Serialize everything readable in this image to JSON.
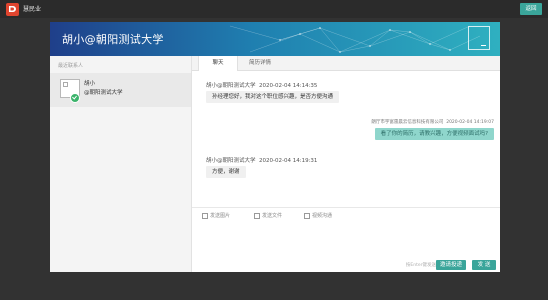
{
  "app": {
    "name": "慧民业",
    "top_button": "返回"
  },
  "modal": {
    "title": "胡小@朝阳测试大学"
  },
  "sidebar": {
    "title": "最近联系人",
    "contacts": [
      {
        "name": "胡小",
        "org": "@朝阳测试大学",
        "status": "online"
      }
    ]
  },
  "tabs": [
    {
      "label": "聊天",
      "active": true
    },
    {
      "label": "简历详情",
      "active": false
    }
  ],
  "messages": [
    {
      "direction": "in",
      "sender": "胡小@朝阳测试大学",
      "time": "2020-02-04 14:14:35",
      "text": "孙经理您好，我对这个职位感兴趣，是否方便沟通"
    },
    {
      "direction": "out",
      "sender": "朗厅市宇富雷晨云信息科技有限公司",
      "time": "2020-02-04 14:19:07",
      "text": "看了你的简历，请教兴趣，方便视频面试吗?"
    },
    {
      "direction": "in",
      "sender": "胡小@朝阳测试大学",
      "time": "2020-02-04 14:19:31",
      "text": "方便，谢谢"
    }
  ],
  "compose": {
    "tools": [
      "发送图片",
      "发送文件",
      "视频沟通"
    ],
    "hint": "按Enter键发送",
    "invite_button": "邀请投递",
    "send_button": "发 送"
  },
  "colors": {
    "accent": "#3aa59a",
    "header_start": "#1f3f8a",
    "header_end": "#2fb0c0",
    "online": "#3bb36b"
  }
}
